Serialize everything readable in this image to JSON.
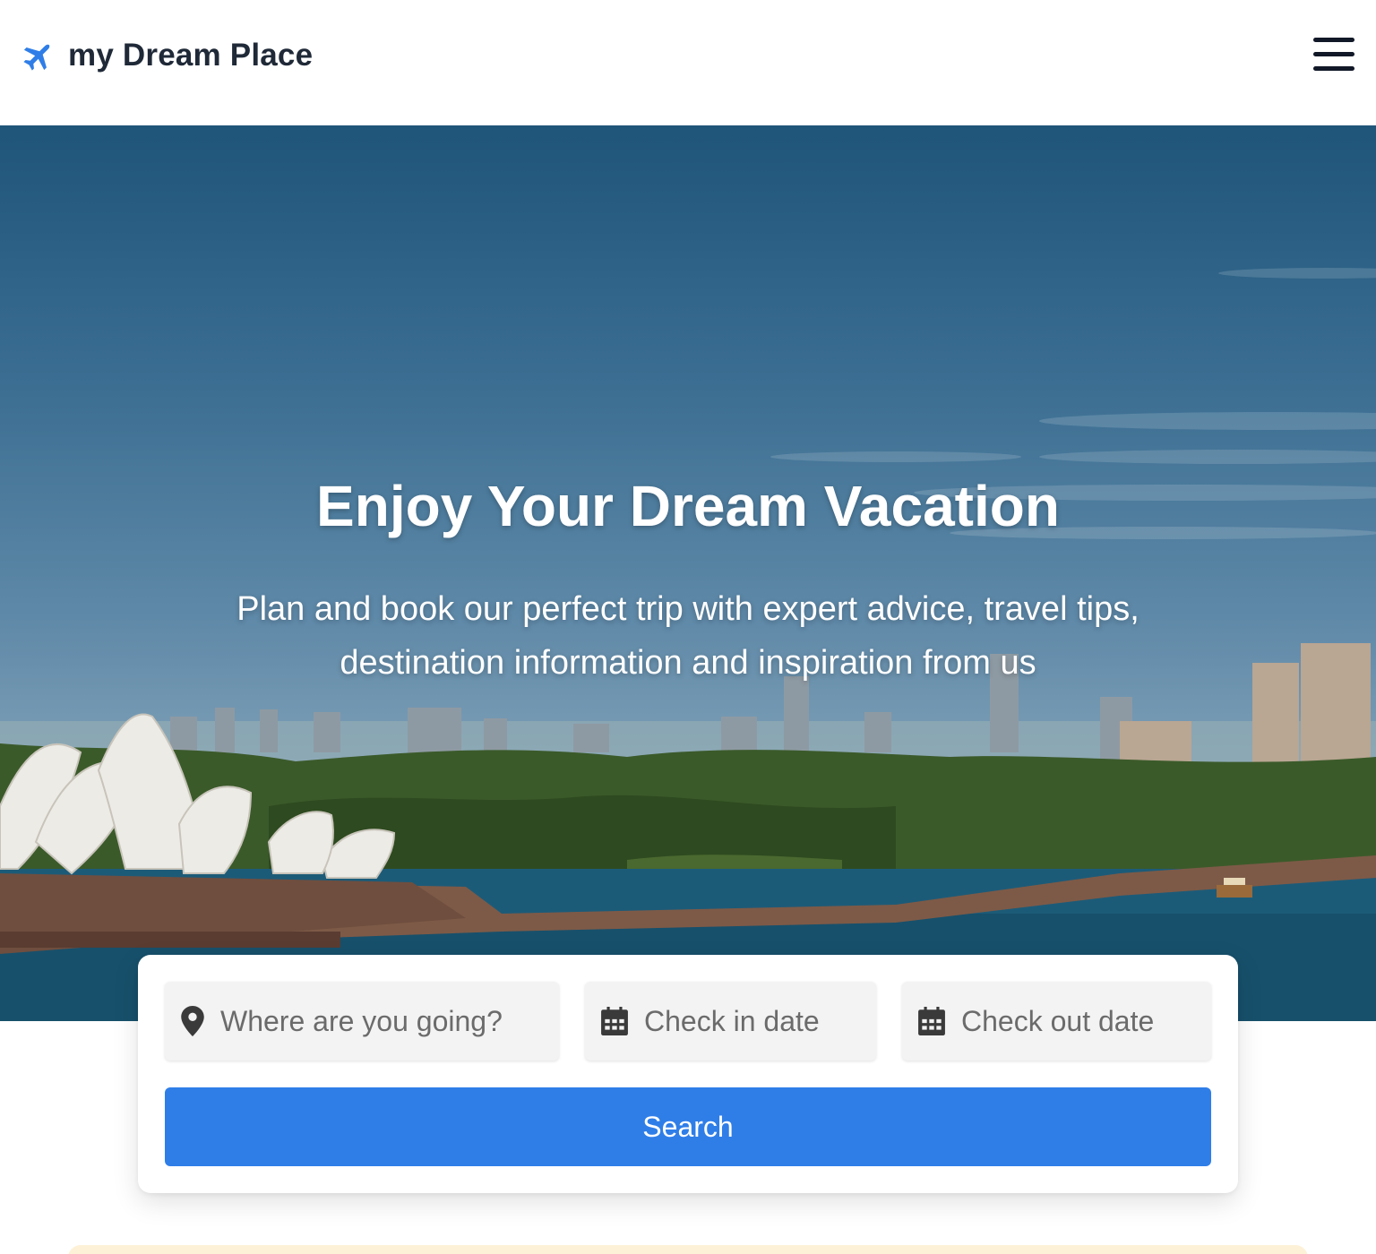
{
  "header": {
    "brand_icon": "airplane-icon",
    "brand_name": "my Dream Place",
    "menu_icon": "hamburger-menu-icon"
  },
  "hero": {
    "title": "Enjoy Your Dream Vacation",
    "subtitle": "Plan and book our perfect trip with expert advice, travel tips, destination information and inspiration from us"
  },
  "search": {
    "destination": {
      "icon": "map-pin-icon",
      "placeholder": "Where are you going?",
      "value": ""
    },
    "check_in": {
      "icon": "calendar-icon",
      "placeholder": "Check in date",
      "value": ""
    },
    "check_out": {
      "icon": "calendar-icon",
      "placeholder": "Check out date",
      "value": ""
    },
    "button_label": "Search"
  },
  "colors": {
    "accent": "#2f7ee8",
    "text_dark": "#1f2937",
    "field_bg": "#f3f3f3"
  }
}
